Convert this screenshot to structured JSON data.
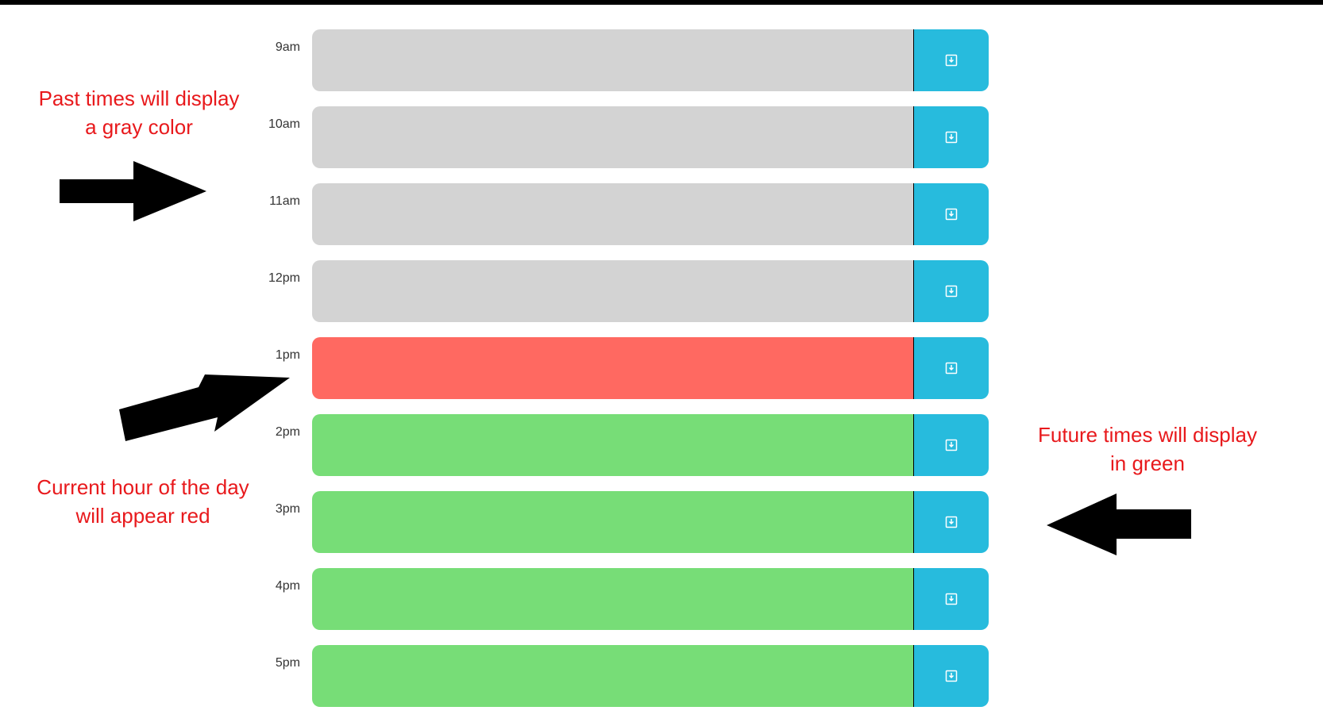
{
  "annotations": {
    "past": [
      "Past times will display",
      "a gray color"
    ],
    "current": [
      "Current hour of the day",
      "will appear red"
    ],
    "future": [
      "Future times will display",
      "in green"
    ]
  },
  "colors": {
    "past": "#d3d3d3",
    "present": "#ff6961",
    "future": "#77dd77",
    "save_button": "#27bbdd",
    "annotation_text": "#e8191c"
  },
  "rows": [
    {
      "hour": "9am",
      "state": "past",
      "icon": "save-icon"
    },
    {
      "hour": "10am",
      "state": "past",
      "icon": "save-icon"
    },
    {
      "hour": "11am",
      "state": "past",
      "icon": "save-icon"
    },
    {
      "hour": "12pm",
      "state": "past",
      "icon": "save-icon"
    },
    {
      "hour": "1pm",
      "state": "present",
      "icon": "save-icon"
    },
    {
      "hour": "2pm",
      "state": "future",
      "icon": "save-icon"
    },
    {
      "hour": "3pm",
      "state": "future",
      "icon": "save-icon"
    },
    {
      "hour": "4pm",
      "state": "future",
      "icon": "save-icon"
    },
    {
      "hour": "5pm",
      "state": "future",
      "icon": "save-icon"
    }
  ]
}
